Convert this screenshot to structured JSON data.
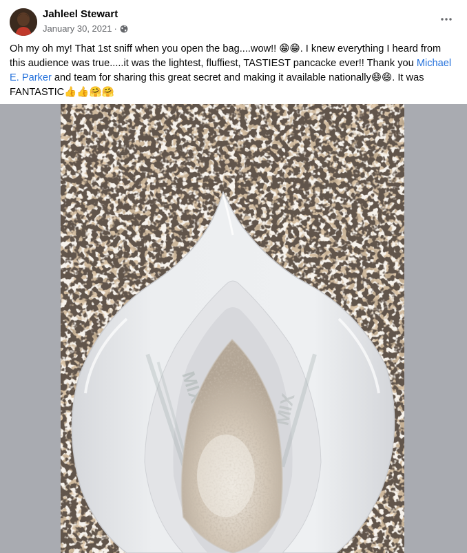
{
  "post": {
    "author": "Jahleel Stewart",
    "date": "January 30, 2021",
    "separator": "·",
    "privacy_icon": "globe-icon",
    "more_icon": "more-horizontal-icon",
    "text": {
      "part1": "Oh my oh my!  That 1st sniff when you open the bag....wow!! 😁😁.  I knew everything I heard from this audience was true.....it was the lightest, fluffiest, TASTIEST pancacke ever!!  Thank you ",
      "mention": "Michael E. Parker",
      "part2": " and team for sharing this great secret and making it available nationally😄😄.  It was FANTASTIC👍👍🤗🤗"
    },
    "photo": {
      "subject": "open white pouch of pancake mix on granite countertop",
      "bag_print": "MIX"
    }
  },
  "colors": {
    "author_text": "#050505",
    "meta_text": "#65676b",
    "mention_link": "#216fdb",
    "photo_backdrop": "#a9abb1"
  }
}
